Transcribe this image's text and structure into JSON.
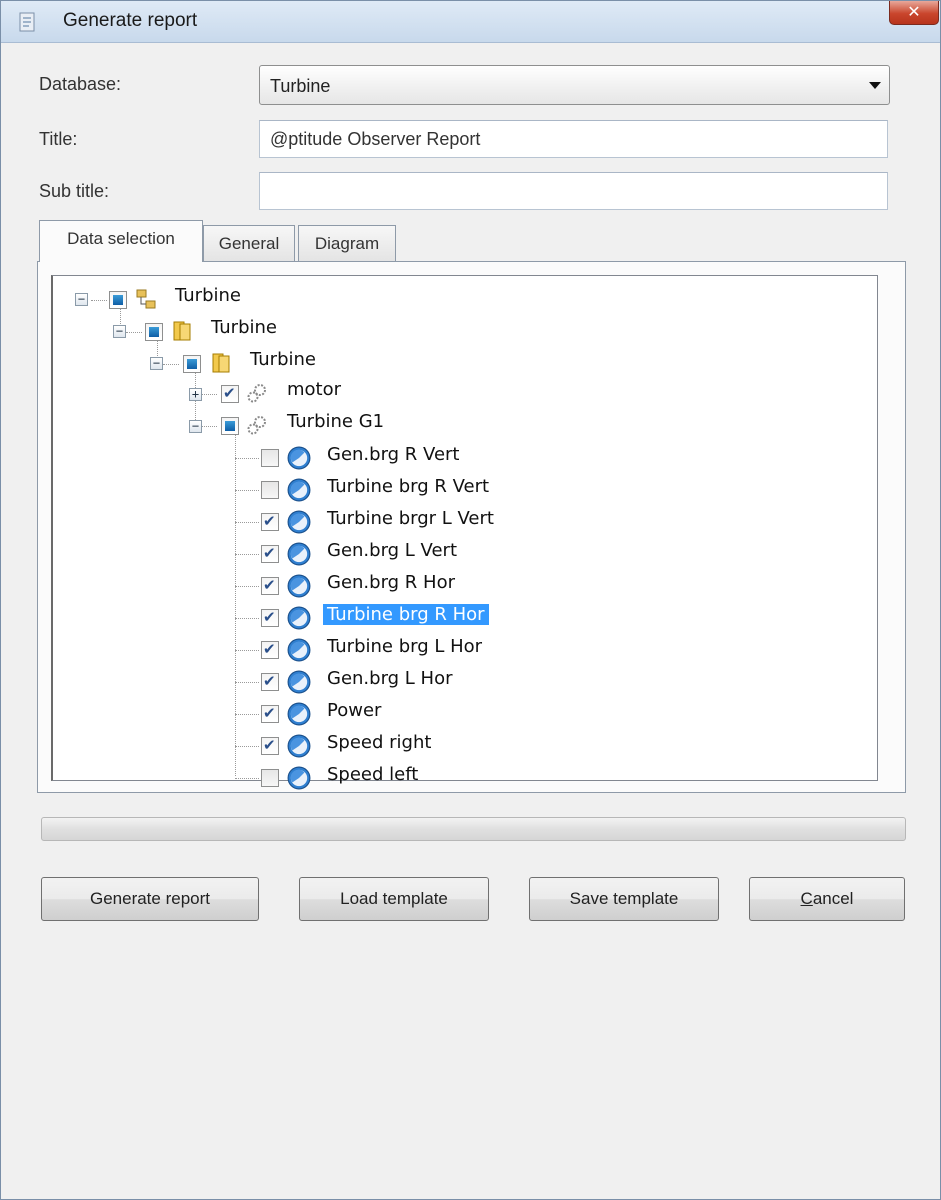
{
  "window": {
    "title": "Generate report",
    "close_glyph": "✕",
    "icon": "report-app-icon"
  },
  "form": {
    "database_label": "Database:",
    "database_value": "Turbine",
    "title_label": "Title:",
    "title_value": "@ptitude Observer Report",
    "subtitle_label": "Sub title:",
    "subtitle_value": ""
  },
  "tabs": [
    {
      "label": "Data selection",
      "active": true
    },
    {
      "label": "General",
      "active": false
    },
    {
      "label": "Diagram",
      "active": false
    }
  ],
  "tree": {
    "root": {
      "label": "Turbine",
      "check": "partial",
      "icon": "database-icon"
    },
    "level1": {
      "label": "Turbine",
      "check": "partial",
      "icon": "folder-icon"
    },
    "level2": {
      "label": "Turbine",
      "check": "partial",
      "icon": "folder-icon"
    },
    "machines": [
      {
        "label": "motor",
        "check": "checked",
        "icon": "gears-icon",
        "expander": "+"
      },
      {
        "label": "Turbine G1",
        "check": "partial",
        "icon": "gears-icon",
        "expander": "-"
      }
    ],
    "points": [
      {
        "label": "Gen.brg R Vert",
        "checked": false
      },
      {
        "label": "Turbine brg R Vert",
        "checked": false
      },
      {
        "label": "Turbine brgr L Vert",
        "checked": true
      },
      {
        "label": "Gen.brg L Vert",
        "checked": true
      },
      {
        "label": "Gen.brg R Hor",
        "checked": true
      },
      {
        "label": "Turbine brg R Hor",
        "checked": true,
        "selected": true
      },
      {
        "label": "Turbine brg L Hor",
        "checked": true
      },
      {
        "label": "Gen.brg L Hor",
        "checked": true
      },
      {
        "label": "Power",
        "checked": true
      },
      {
        "label": "Speed right",
        "checked": true
      },
      {
        "label": "Speed left",
        "checked": false
      }
    ]
  },
  "buttons": {
    "generate": "Generate report",
    "load": "Load template",
    "save": "Save template",
    "cancel_first": "C",
    "cancel_rest": "ancel"
  },
  "colors": {
    "selection": "#3399ff",
    "check_fill": "#1a6fbf"
  }
}
